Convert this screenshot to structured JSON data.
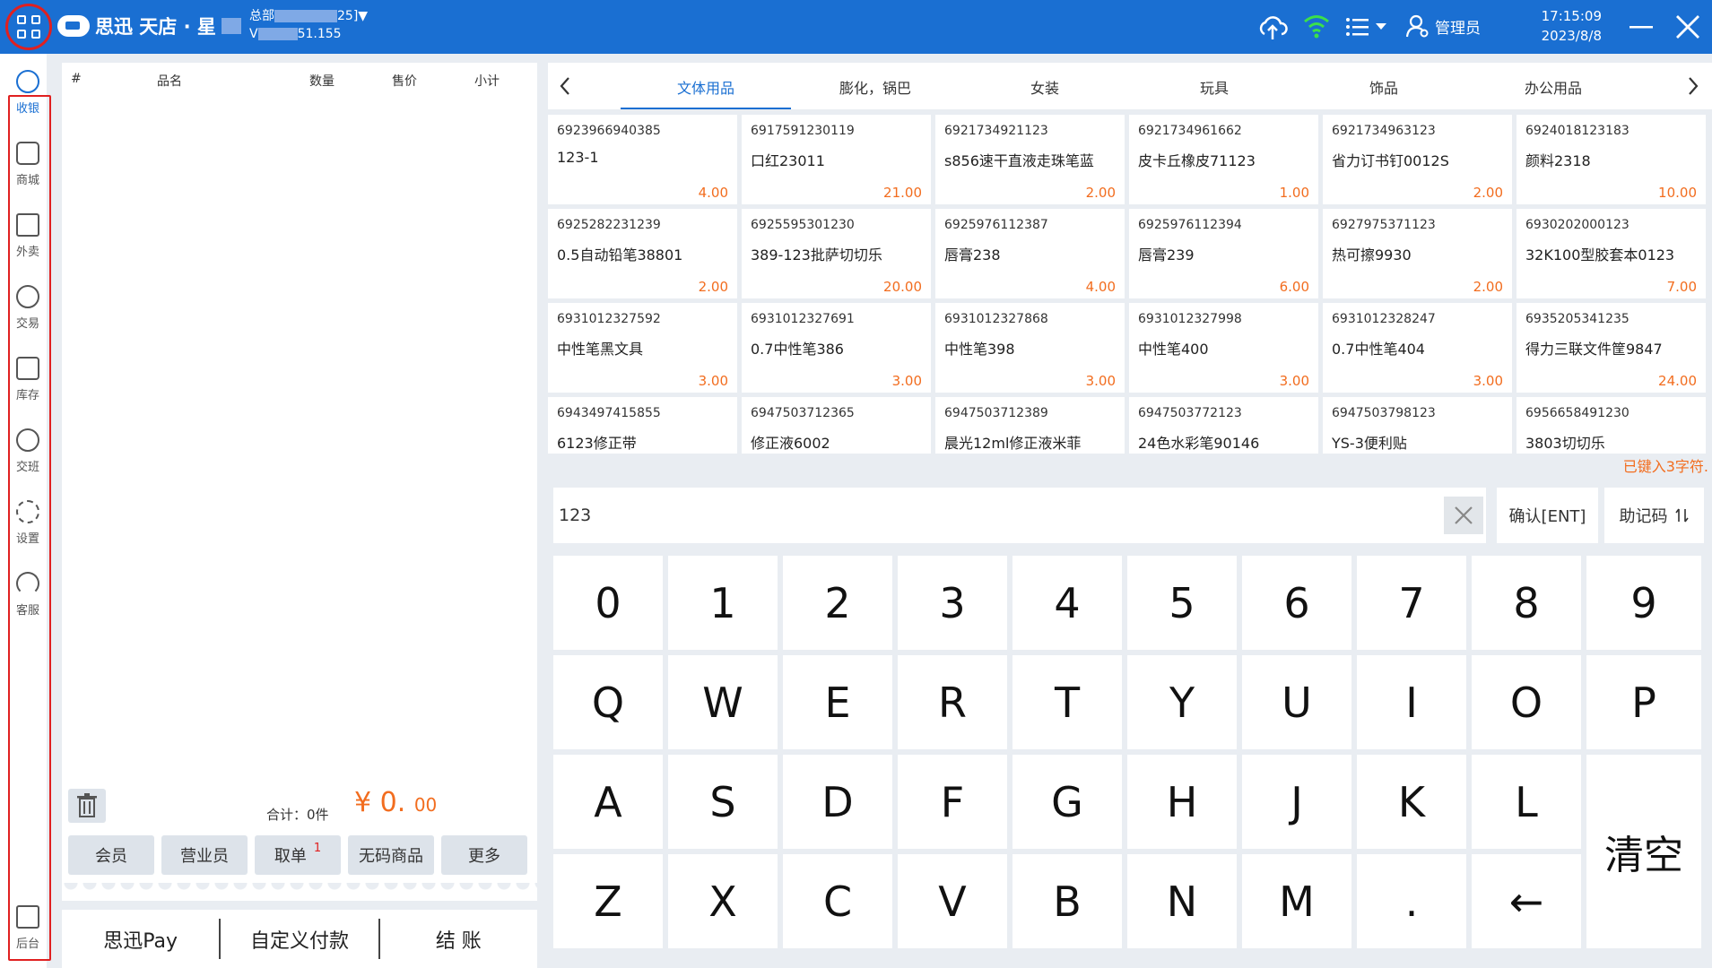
{
  "header": {
    "brand": "思迅 天店 · 星",
    "store_label": "总部",
    "store_suffix": "25]▼",
    "version_prefix": "V",
    "version_suffix": "51.155",
    "user_label": "管理员",
    "time": "17:15:09",
    "date": "2023/8/8"
  },
  "nav": [
    {
      "label": "收银",
      "icon": "cashier-icon",
      "active": true
    },
    {
      "label": "商城",
      "icon": "store-icon"
    },
    {
      "label": "外卖",
      "icon": "delivery-icon"
    },
    {
      "label": "交易",
      "icon": "transaction-icon"
    },
    {
      "label": "库存",
      "icon": "inventory-icon"
    },
    {
      "label": "交班",
      "icon": "handover-icon"
    },
    {
      "label": "设置",
      "icon": "settings-icon"
    },
    {
      "label": "客服",
      "icon": "headset-icon"
    },
    {
      "label": "后台",
      "icon": "backend-icon"
    }
  ],
  "order": {
    "columns": [
      "#",
      "品名",
      "数量",
      "售价",
      "小计"
    ],
    "total_label": "合计：0件",
    "currency": "¥",
    "amount_int": "0.",
    "amount_dec": "00",
    "actions": [
      "会员",
      "营业员",
      "取单",
      "无码商品",
      "更多"
    ],
    "pickup_badge": "1",
    "payments": [
      "思迅Pay",
      "自定义付款",
      "结 账"
    ]
  },
  "categories": [
    "文体用品",
    "膨化，锅巴",
    "女装",
    "玩具",
    "饰品",
    "办公用品"
  ],
  "active_category": "文体用品",
  "products": [
    {
      "code": "6923966940385",
      "name": "123-1",
      "price": "4.00"
    },
    {
      "code": "6917591230119",
      "name": "口红23011",
      "price": "21.00"
    },
    {
      "code": "6921734921123",
      "name": "s856速干直液走珠笔蓝",
      "price": "2.00"
    },
    {
      "code": "6921734961662",
      "name": "皮卡丘橡皮71123",
      "price": "1.00"
    },
    {
      "code": "6921734963123",
      "name": "省力订书钉0012S",
      "price": "2.00"
    },
    {
      "code": "6924018123183",
      "name": "颜料2318",
      "price": "10.00"
    },
    {
      "code": "6925282231239",
      "name": "0.5自动铅笔38801",
      "price": "2.00"
    },
    {
      "code": "6925595301230",
      "name": "389-123批萨切切乐",
      "price": "20.00"
    },
    {
      "code": "6925976112387",
      "name": "唇膏238",
      "price": "4.00"
    },
    {
      "code": "6925976112394",
      "name": "唇膏239",
      "price": "6.00"
    },
    {
      "code": "6927975371123",
      "name": "热可擦9930",
      "price": "2.00"
    },
    {
      "code": "6930202000123",
      "name": "32K100型胶套本0123",
      "price": "7.00"
    },
    {
      "code": "6931012327592",
      "name": "中性笔黑文具",
      "price": "3.00"
    },
    {
      "code": "6931012327691",
      "name": "0.7中性笔386",
      "price": "3.00"
    },
    {
      "code": "6931012327868",
      "name": "中性笔398",
      "price": "3.00"
    },
    {
      "code": "6931012327998",
      "name": "中性笔400",
      "price": "3.00"
    },
    {
      "code": "6931012328247",
      "name": "0.7中性笔404",
      "price": "3.00"
    },
    {
      "code": "6935205341235",
      "name": "得力三联文件筐9847",
      "price": "24.00"
    },
    {
      "code": "6943497415855",
      "name": "6123修正带",
      "price": ""
    },
    {
      "code": "6947503712365",
      "name": "修正液6002",
      "price": ""
    },
    {
      "code": "6947503712389",
      "name": "晨光12ml修正液米菲",
      "price": ""
    },
    {
      "code": "6947503772123",
      "name": "24色水彩笔90146",
      "price": ""
    },
    {
      "code": "6947503798123",
      "name": "YS-3便利贴",
      "price": ""
    },
    {
      "code": "6956658491230",
      "name": "3803切切乐",
      "price": ""
    }
  ],
  "typed_note": "已键入3字符.",
  "search": {
    "value": "123"
  },
  "confirm_label": "确认[ENT]",
  "memo_label": "助记码",
  "keys": {
    "row1": [
      "0",
      "1",
      "2",
      "3",
      "4",
      "5",
      "6",
      "7",
      "8",
      "9"
    ],
    "row2": [
      "Q",
      "W",
      "E",
      "R",
      "T",
      "Y",
      "U",
      "I",
      "O",
      "P"
    ],
    "row3": [
      "A",
      "S",
      "D",
      "F",
      "G",
      "H",
      "J",
      "K",
      "L"
    ],
    "row4": [
      "Z",
      "X",
      "C",
      "V",
      "B",
      "N",
      "M",
      ".",
      "←"
    ],
    "clear": "清空"
  },
  "colors": {
    "brand": "#1a6fd2",
    "accent": "#f26d1f",
    "highlight": "#e02020"
  }
}
